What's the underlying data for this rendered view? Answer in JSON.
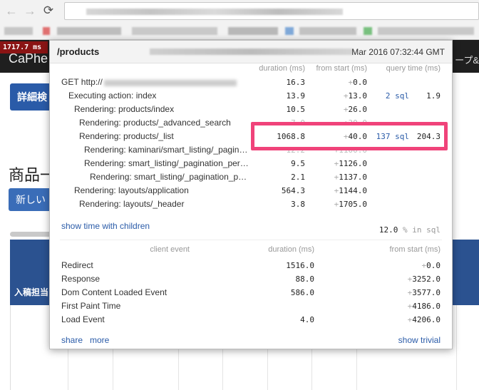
{
  "browser": {
    "back_icon": "←",
    "forward_icon": "→",
    "reload_icon": "C"
  },
  "page": {
    "brand": "CaPhe",
    "nav_right": "ープ&",
    "detail_button": "詳細検",
    "title": "商品一",
    "new_button": "新しい",
    "table_header_label": "入稿担当"
  },
  "badge": {
    "text": "1717.7 ms"
  },
  "profiler": {
    "path": "/products",
    "date": "Mar 2016 07:32:44 GMT",
    "headers": {
      "duration": "duration (ms)",
      "from_start": "from start (ms)",
      "query_time": "query time (ms)"
    },
    "rows": [
      {
        "name": "GET http://",
        "duration": "16.3",
        "from_start": "0.0",
        "sql": "",
        "query_time": ""
      },
      {
        "name": "Executing action: index",
        "duration": "13.9",
        "from_start": "13.0",
        "sql": "2 sql",
        "query_time": "1.9"
      },
      {
        "name": "Rendering: products/index",
        "duration": "10.5",
        "from_start": "26.0",
        "sql": "",
        "query_time": ""
      },
      {
        "name": "Rendering: products/_advanced_search",
        "duration": "7.0",
        "from_start": "30.0",
        "sql": "",
        "query_time": ""
      },
      {
        "name": "Rendering: products/_list",
        "duration": "1068.8",
        "from_start": "40.0",
        "sql": "137 sql",
        "query_time": "204.3"
      },
      {
        "name": "Rendering: kaminari/smart_listing/_pagin…",
        "duration": "12.2",
        "from_start": "1100.0",
        "sql": "",
        "query_time": ""
      },
      {
        "name": "Rendering: smart_listing/_pagination_per…",
        "duration": "9.5",
        "from_start": "1126.0",
        "sql": "",
        "query_time": ""
      },
      {
        "name": "Rendering: smart_listing/_pagination_p…",
        "duration": "2.1",
        "from_start": "1137.0",
        "sql": "",
        "query_time": ""
      },
      {
        "name": "Rendering: layouts/application",
        "duration": "564.3",
        "from_start": "1144.0",
        "sql": "",
        "query_time": ""
      },
      {
        "name": "Rendering: layouts/_header",
        "duration": "3.8",
        "from_start": "1705.0",
        "sql": "",
        "query_time": ""
      }
    ],
    "show_children_link": "show time with children",
    "sql_percent": "12.0",
    "sql_percent_suffix": "% in sql",
    "client_headers": {
      "event": "client event",
      "duration": "duration (ms)",
      "from_start": "from start (ms)"
    },
    "client_rows": [
      {
        "name": "Redirect",
        "duration": "1516.0",
        "from_start": "0.0"
      },
      {
        "name": "Response",
        "duration": "88.0",
        "from_start": "3252.0"
      },
      {
        "name": "Dom Content Loaded Event",
        "duration": "586.0",
        "from_start": "3577.0"
      },
      {
        "name": "First Paint Time",
        "duration": "",
        "from_start": "4186.0"
      },
      {
        "name": "Load Event",
        "duration": "4.0",
        "from_start": "4206.0"
      }
    ],
    "share_link": "share",
    "more_link": "more",
    "trivial_link": "show trivial"
  },
  "colors": {
    "highlight": "#f0437a",
    "link": "#2a5ba8",
    "badge": "#8a1414"
  }
}
